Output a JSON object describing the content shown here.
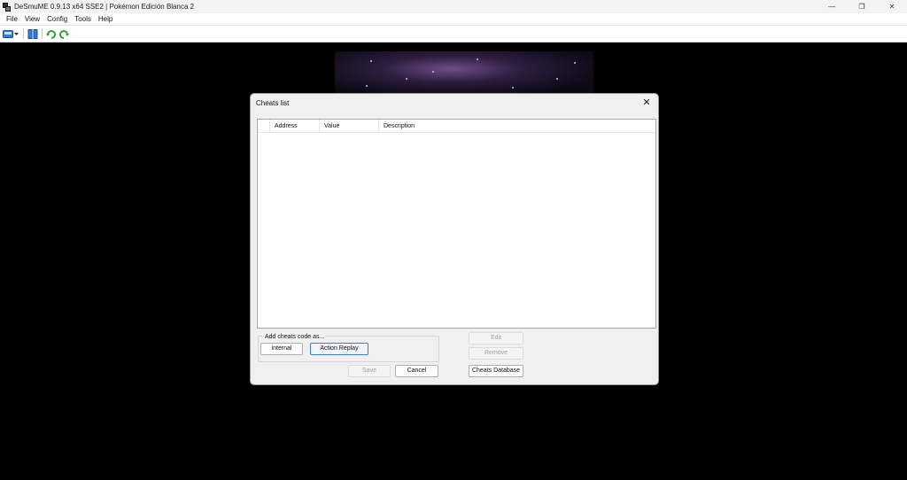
{
  "window": {
    "title": "DeSmuME 0.9.13 x64 SSE2 | Pokémon Edición Blanca 2",
    "minimize": "—",
    "restore": "❐",
    "close": "✕"
  },
  "menu": [
    "File",
    "View",
    "Config",
    "Tools",
    "Help"
  ],
  "toolbar": {
    "icons": [
      "open-rom-icon",
      "dropdown-arrow-icon",
      "pause-icon",
      "reset-icon",
      "rotate-icon"
    ]
  },
  "dialog": {
    "title": "Cheats list",
    "close": "✕",
    "columns": [
      "Address",
      "Value",
      "Description"
    ],
    "add_group_label": "Add cheats code as...",
    "internal_label": "internal",
    "action_replay_label": "Action Replay",
    "save_label": "Save",
    "cancel_label": "Cancel",
    "edit_label": "Edit",
    "remove_label": "Remove",
    "database_label": "Cheats Database"
  }
}
